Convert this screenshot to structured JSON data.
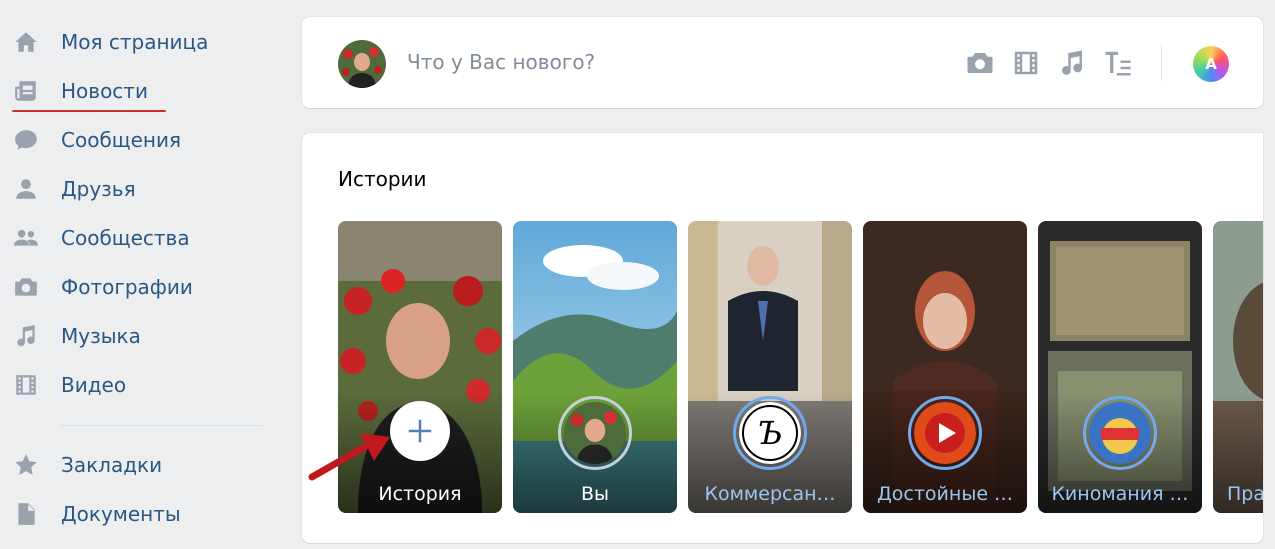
{
  "sidebar": {
    "items": [
      {
        "label": "Моя страница",
        "icon": "home-icon"
      },
      {
        "label": "Новости",
        "icon": "news-icon"
      },
      {
        "label": "Сообщения",
        "icon": "messages-icon"
      },
      {
        "label": "Друзья",
        "icon": "friends-icon"
      },
      {
        "label": "Сообщества",
        "icon": "communities-icon"
      },
      {
        "label": "Фотографии",
        "icon": "photo-icon"
      },
      {
        "label": "Музыка",
        "icon": "music-icon"
      },
      {
        "label": "Видео",
        "icon": "video-icon"
      }
    ],
    "items2": [
      {
        "label": "Закладки",
        "icon": "star-icon"
      },
      {
        "label": "Документы",
        "icon": "document-icon"
      }
    ]
  },
  "composer": {
    "placeholder": "Что у Вас нового?",
    "tools": [
      "camera-icon",
      "film-icon",
      "music-note-icon",
      "text-format-icon"
    ],
    "aa_label": "A"
  },
  "stories": {
    "title": "Истории",
    "items": [
      {
        "label": "История",
        "type": "add"
      },
      {
        "label": "Вы",
        "type": "own"
      },
      {
        "label": "Коммерсан…",
        "type": "channel"
      },
      {
        "label": "Достойные …",
        "type": "channel"
      },
      {
        "label": "Киномания …",
        "type": "channel"
      },
      {
        "label": "Пра",
        "type": "channel"
      }
    ]
  },
  "colors": {
    "link": "#2a5885",
    "accent": "#71aaeb",
    "background": "#edeef0",
    "icon": "#99a2ad",
    "highlight": "#c6322f"
  }
}
